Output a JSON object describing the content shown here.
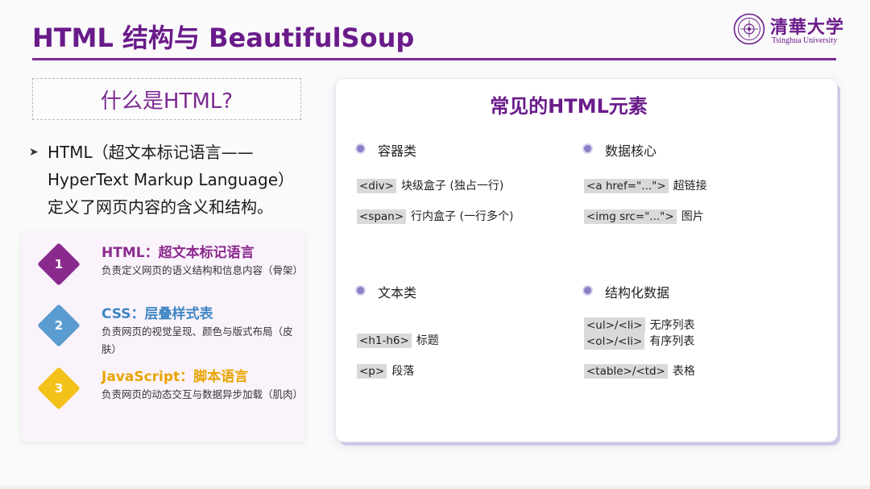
{
  "slide": {
    "title": "HTML 结构与 BeautifulSoup",
    "logo": {
      "cn": "清華大学",
      "en": "Tsinghua University"
    }
  },
  "question": "什么是HTML?",
  "definition": {
    "bullet": "➤",
    "text": "HTML（超文本标记语言——HyperText Markup Language）定义了网页内容的含义和结构。"
  },
  "languages": [
    {
      "num": "1",
      "title": "HTML：超文本标记语言",
      "desc": "负责定义网页的语义结构和信息内容（骨架）",
      "color": "#8b2a8e",
      "title_color": "#8b2a8e"
    },
    {
      "num": "2",
      "title": "CSS：层叠样式表",
      "desc": "负责网页的视觉呈现、颜色与版式布局（皮肤）",
      "color": "#5a9bd0",
      "title_color": "#3f86c3"
    },
    {
      "num": "3",
      "title": "JavaScript：脚本语言",
      "desc": "负责网页的动态交互与数据异步加载（肌肉）",
      "color": "#f2c21a",
      "title_color": "#e8a400"
    }
  ],
  "elements": {
    "title": "常见的HTML元素",
    "categories": [
      {
        "label": "容器类",
        "rows": [
          {
            "code": "<div>",
            "desc": "块级盒子 (独占一行)"
          },
          {
            "code": "<span>",
            "desc": "行内盒子 (一行多个)"
          }
        ]
      },
      {
        "label": "数据核心",
        "rows": [
          {
            "code": "<a href=\"...\">",
            "desc": "超链接"
          },
          {
            "code": "<img src=\"...\">",
            "desc": "图片"
          }
        ]
      },
      {
        "label": "文本类",
        "rows": [
          {
            "code": "<h1-h6>",
            "desc": "标题"
          },
          {
            "code": "<p>",
            "desc": "段落"
          }
        ]
      },
      {
        "label": "结构化数据",
        "rows": [
          {
            "code": "<ul>/<li>",
            "desc": "无序列表"
          },
          {
            "code": "<ol>/<li>",
            "desc": "有序列表"
          },
          {
            "code": "<table>/<td>",
            "desc": "表格"
          }
        ]
      }
    ]
  }
}
